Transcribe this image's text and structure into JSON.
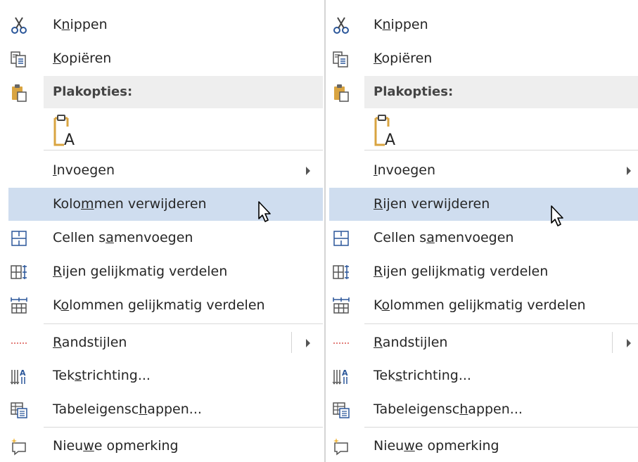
{
  "menus": [
    {
      "id": "left",
      "items": [
        {
          "key": "cut",
          "pre": "K",
          "ul": "n",
          "post": "ippen",
          "icon": "scissors-icon"
        },
        {
          "key": "copy",
          "pre": "",
          "ul": "K",
          "post": "opiëren",
          "icon": "copy-icon"
        },
        {
          "key": "paste_header",
          "text": "Plakopties:",
          "icon": "clipboard-icon"
        },
        {
          "key": "paste_option",
          "icon": "paste-text-only-icon"
        },
        {
          "key": "insert",
          "pre": "",
          "ul": "I",
          "post": "nvoegen",
          "submenu": true
        },
        {
          "key": "delete",
          "pre": "Kolo",
          "ul": "m",
          "post": "men verwijderen",
          "highlighted": true
        },
        {
          "key": "merge",
          "pre": "Cellen s",
          "ul": "a",
          "post": "menvoegen",
          "icon": "merge-cells-icon"
        },
        {
          "key": "distribute_rows",
          "pre": "",
          "ul": "R",
          "post": "ijen gelijkmatig verdelen",
          "icon": "distribute-rows-icon"
        },
        {
          "key": "distribute_cols",
          "pre": "K",
          "ul": "o",
          "post": "lommen gelijkmatig verdelen",
          "icon": "distribute-columns-icon"
        },
        {
          "key": "border_styles",
          "pre": "",
          "ul": "R",
          "post": "andstijlen",
          "icon": "border-styles-icon",
          "submenu": true,
          "split": true
        },
        {
          "key": "text_direction",
          "pre": "Tek",
          "ul": "s",
          "post": "trichting...",
          "icon": "text-direction-icon"
        },
        {
          "key": "table_props",
          "pre": "Tabeleigensc",
          "ul": "h",
          "post": "appen...",
          "icon": "table-properties-icon"
        },
        {
          "key": "new_comment",
          "pre": "Nieu",
          "ul": "w",
          "post": "e opmerking",
          "icon": "new-comment-icon"
        }
      ]
    },
    {
      "id": "right",
      "items": [
        {
          "key": "cut",
          "pre": "K",
          "ul": "n",
          "post": "ippen",
          "icon": "scissors-icon"
        },
        {
          "key": "copy",
          "pre": "",
          "ul": "K",
          "post": "opiëren",
          "icon": "copy-icon"
        },
        {
          "key": "paste_header",
          "text": "Plakopties:",
          "icon": "clipboard-icon"
        },
        {
          "key": "paste_option",
          "icon": "paste-text-only-icon"
        },
        {
          "key": "insert",
          "pre": "",
          "ul": "I",
          "post": "nvoegen",
          "submenu": true
        },
        {
          "key": "delete",
          "pre": "",
          "ul": "R",
          "post": "ijen verwijderen",
          "highlighted": true
        },
        {
          "key": "merge",
          "pre": "Cellen s",
          "ul": "a",
          "post": "menvoegen",
          "icon": "merge-cells-icon"
        },
        {
          "key": "distribute_rows",
          "pre": "",
          "ul": "R",
          "post": "ijen gelijkmatig verdelen",
          "icon": "distribute-rows-icon"
        },
        {
          "key": "distribute_cols",
          "pre": "K",
          "ul": "o",
          "post": "lommen gelijkmatig verdelen",
          "icon": "distribute-columns-icon"
        },
        {
          "key": "border_styles",
          "pre": "",
          "ul": "R",
          "post": "andstijlen",
          "icon": "border-styles-icon",
          "submenu": true,
          "split": true
        },
        {
          "key": "text_direction",
          "pre": "Tek",
          "ul": "s",
          "post": "trichting...",
          "icon": "text-direction-icon"
        },
        {
          "key": "table_props",
          "pre": "Tabeleigensc",
          "ul": "h",
          "post": "appen...",
          "icon": "table-properties-icon"
        },
        {
          "key": "new_comment",
          "pre": "Nieu",
          "ul": "w",
          "post": "e opmerking",
          "icon": "new-comment-icon"
        }
      ]
    }
  ],
  "colors": {
    "highlight": "#cfddef",
    "header": "#eeeeee",
    "icon_blue": "#2b579a",
    "icon_gold": "#d9a441",
    "text": "#262626"
  }
}
